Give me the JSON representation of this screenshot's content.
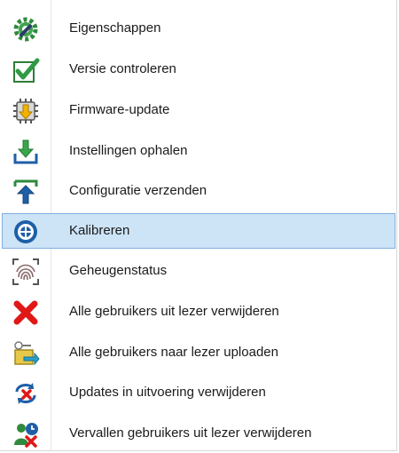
{
  "menu": {
    "items": [
      {
        "label": "Eigenschappen",
        "icon": "gear-wrench-icon"
      },
      {
        "label": "Versie controleren",
        "icon": "checkmark-icon"
      },
      {
        "label": "Firmware-update",
        "icon": "chip-arrow-icon"
      },
      {
        "label": "Instellingen ophalen",
        "icon": "download-tray-icon"
      },
      {
        "label": "Configuratie verzenden",
        "icon": "upload-tray-icon"
      },
      {
        "label": "Kalibreren",
        "icon": "target-icon",
        "selected": true
      },
      {
        "label": "Geheugenstatus",
        "icon": "fingerprint-icon"
      },
      {
        "label": "Alle gebruikers uit lezer verwijderen",
        "icon": "red-x-icon"
      },
      {
        "label": "Alle gebruikers naar lezer uploaden",
        "icon": "users-upload-icon"
      },
      {
        "label": "Updates in uitvoering verwijderen",
        "icon": "sync-delete-icon"
      },
      {
        "label": "Vervallen gebruikers uit lezer verwijderen",
        "icon": "expired-user-delete-icon"
      }
    ]
  },
  "colors": {
    "selection_bg": "#cde4f7",
    "selection_border": "#7fb0e0"
  }
}
